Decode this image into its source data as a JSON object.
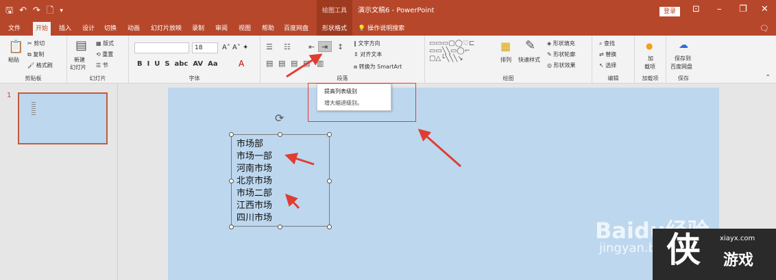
{
  "titlebar": {
    "contextual_group": "绘图工具",
    "doc_title": "演示文稿6 - PowerPoint",
    "login": "登录"
  },
  "tabs": [
    "文件",
    "开始",
    "插入",
    "设计",
    "切换",
    "动画",
    "幻灯片放映",
    "录制",
    "审阅",
    "视图",
    "帮助",
    "百度网盘",
    "形状格式"
  ],
  "tell_me": "操作说明搜索",
  "ribbon": {
    "clipboard": {
      "paste": "粘贴",
      "cut": "剪切",
      "copy": "复制",
      "format_painter": "格式刷",
      "label": "剪贴板"
    },
    "slides": {
      "new_slide_1": "新建",
      "new_slide_2": "幻灯片",
      "layout": "版式",
      "reset": "重置",
      "section": "节",
      "label": "幻灯片"
    },
    "font": {
      "size": "18",
      "label": "字体"
    },
    "paragraph": {
      "text_direction": "文字方向",
      "align_text": "对齐文本",
      "smartart": "转换为 SmartArt",
      "label": "段落"
    },
    "drawing": {
      "arrange": "排列",
      "quick_styles": "快速样式",
      "shape_fill": "形状填充",
      "shape_outline": "形状轮廓",
      "shape_effects": "形状效果",
      "label": "绘图"
    },
    "editing": {
      "find": "查找",
      "replace": "替换",
      "select": "选择",
      "label": "编辑"
    },
    "addins": {
      "line1": "加",
      "line2": "载项",
      "label": "加载项"
    },
    "save": {
      "line1": "保存到",
      "line2": "百度网盘",
      "label": "保存"
    }
  },
  "tooltip": {
    "title": "提高列表级别",
    "desc": "增大缩进级别。"
  },
  "slide_number": "1",
  "textbox_lines": [
    "市场部",
    "市场一部",
    "河南市场",
    "北京市场",
    "市场二部",
    "江西市场",
    "四川市场"
  ],
  "watermark": {
    "baidu": "Baidu经验",
    "jingyan": "jingyan.baidu.com",
    "site": "xiayx.com",
    "logo": "游戏",
    "char": "侠"
  },
  "colors": {
    "accent": "#b7472a",
    "slide_bg": "#bdd7ee",
    "annotation": "#e03c31"
  }
}
